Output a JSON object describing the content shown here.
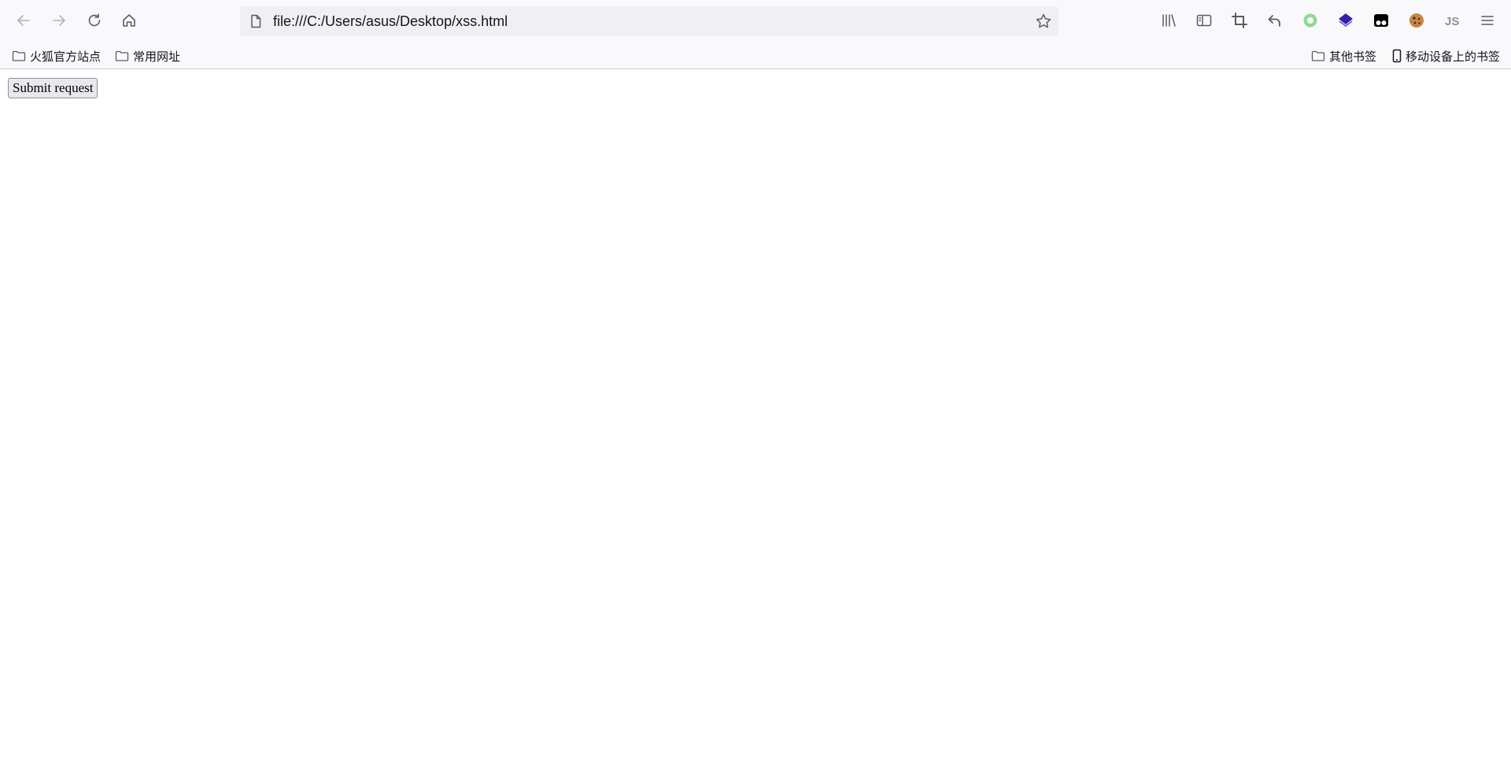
{
  "browser": {
    "url": "file:///C:/Users/asus/Desktop/xss.html"
  },
  "toolbar": {
    "icons": [
      "back-icon",
      "forward-icon",
      "reload-icon",
      "home-icon",
      "page-icon",
      "bookmark-star-icon",
      "library-icon",
      "sidebar-icon",
      "screenshot-crop-icon",
      "undo-icon",
      "green-circle-extension-icon",
      "purple-layers-extension-icon",
      "mask-extension-icon",
      "cookie-extension-icon",
      "js-extension-icon",
      "menu-icon"
    ],
    "js_label": "JS"
  },
  "bookmarks": {
    "left": [
      {
        "label": "火狐官方站点"
      },
      {
        "label": "常用网址"
      }
    ],
    "right": [
      {
        "label": "其他书签"
      },
      {
        "label": "移动设备上的书签"
      }
    ]
  },
  "page": {
    "submit_label": "Submit request"
  },
  "colors": {
    "chrome_bg": "#f9f9fb",
    "urlbar_bg": "#f0f0f4",
    "icon": "#5b5b66",
    "disabled_icon": "#b1b1b8",
    "green_ext": "#8fd98f",
    "purple_ext": "#3b1ea8"
  }
}
